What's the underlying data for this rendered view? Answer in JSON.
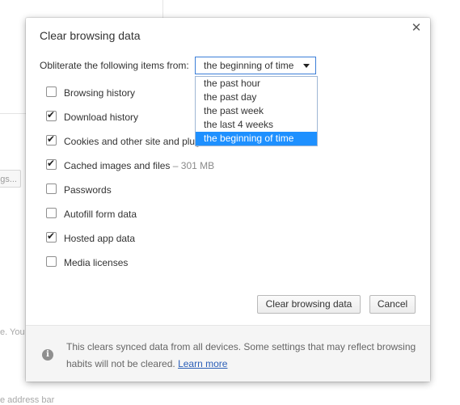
{
  "background_page": {
    "button_fragment": "gs...",
    "text_fragment_1": "e. You",
    "text_fragment_2": "e address bar"
  },
  "dialog": {
    "title": "Clear browsing data",
    "close_glyph": "✕",
    "obliterate_label": "Obliterate the following items from:",
    "time_range": {
      "selected": "the beginning of time",
      "options": [
        "the past hour",
        "the past day",
        "the past week",
        "the last 4 weeks",
        "the beginning of time"
      ]
    },
    "checkboxes": [
      {
        "label": "Browsing history",
        "checked": false
      },
      {
        "label": "Download history",
        "checked": true
      },
      {
        "label": "Cookies and other site and plugin data",
        "checked": true
      },
      {
        "label": "Cached images and files",
        "note": " – 301 MB",
        "checked": true
      },
      {
        "label": "Passwords",
        "checked": false
      },
      {
        "label": "Autofill form data",
        "checked": false
      },
      {
        "label": "Hosted app data",
        "checked": true
      },
      {
        "label": "Media licenses",
        "checked": false
      }
    ],
    "buttons": {
      "clear": "Clear browsing data",
      "cancel": "Cancel"
    },
    "footer": {
      "icon": "info-icon",
      "text": "This clears synced data from all devices. Some settings that may reflect browsing habits will not be cleared. ",
      "link": "Learn more"
    }
  },
  "colors": {
    "selected_option_bg": "#1e90ff",
    "select_border": "#3b7ed8",
    "link": "#2b5fb8",
    "footer_bg": "#f5f5f5"
  }
}
